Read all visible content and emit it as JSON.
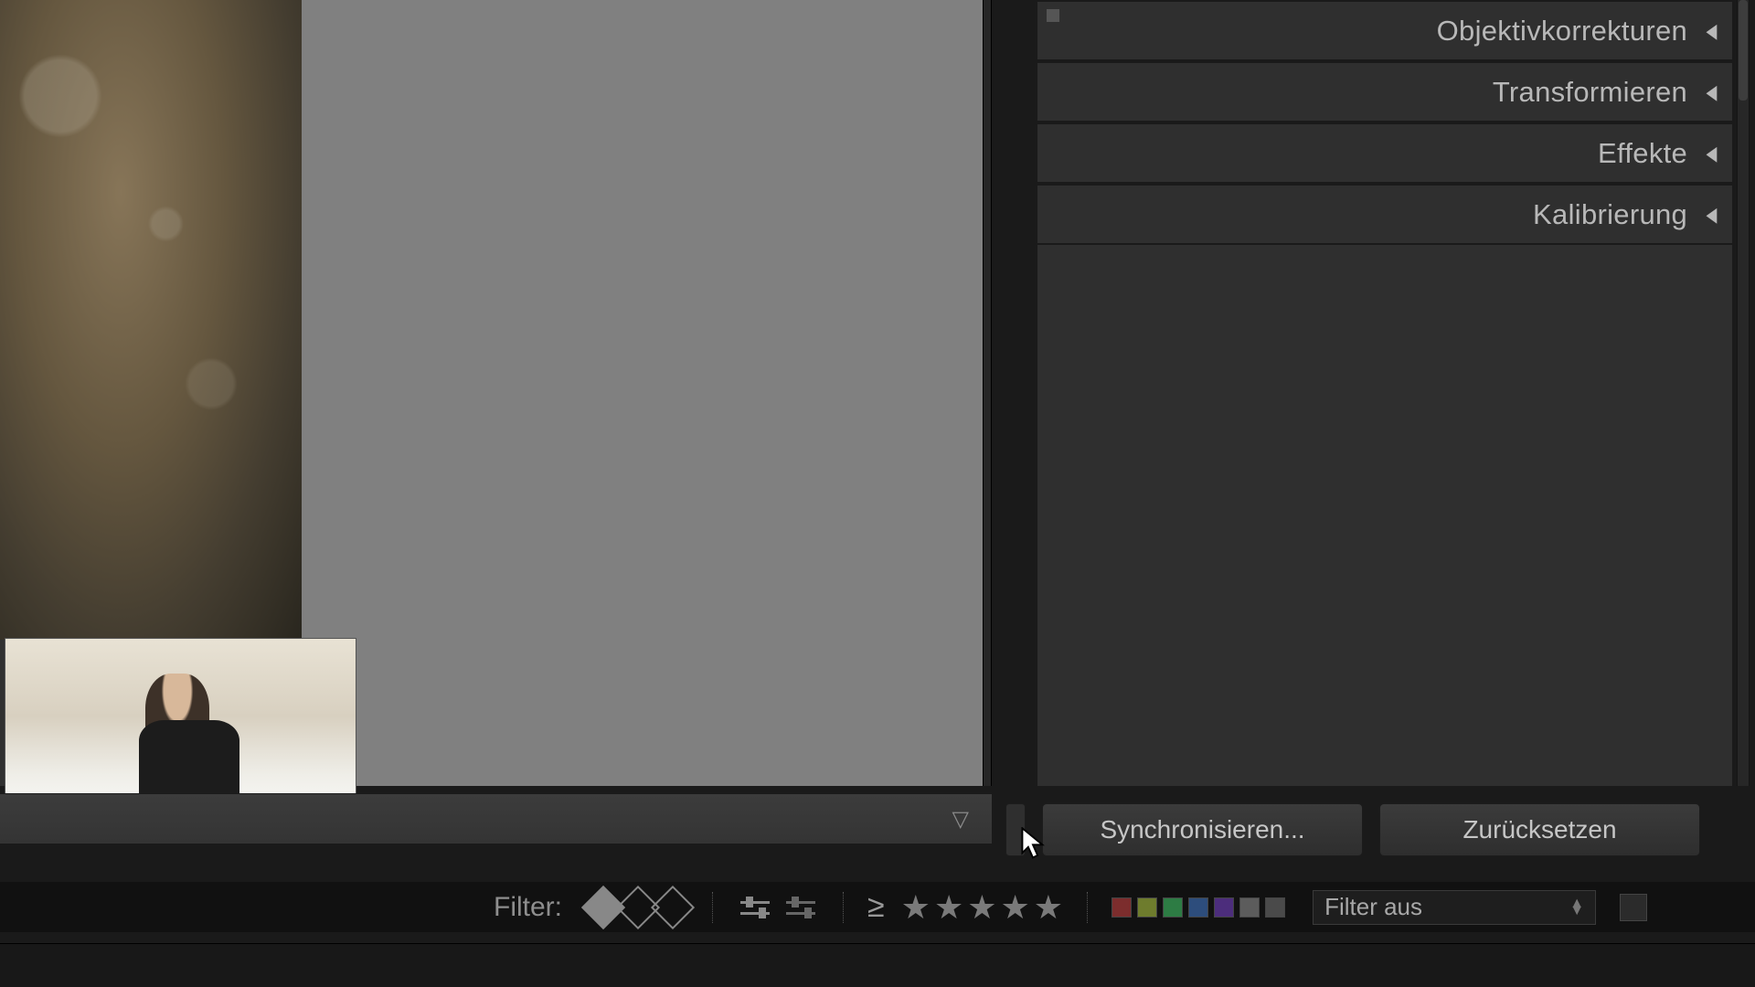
{
  "panels": [
    {
      "label": "Objektivkorrekturen"
    },
    {
      "label": "Transformieren"
    },
    {
      "label": "Effekte"
    },
    {
      "label": "Kalibrierung"
    }
  ],
  "buttons": {
    "sync": "Synchronisieren...",
    "reset": "Zurücksetzen"
  },
  "filter": {
    "label": "Filter:",
    "dropdown": "Filter aus",
    "color_chips": [
      "#7c2d2d",
      "#6e7c2d",
      "#2d7c44",
      "#2d4d7c",
      "#4c2d7c",
      "#5c5c5c",
      "#4a4a4a"
    ]
  }
}
